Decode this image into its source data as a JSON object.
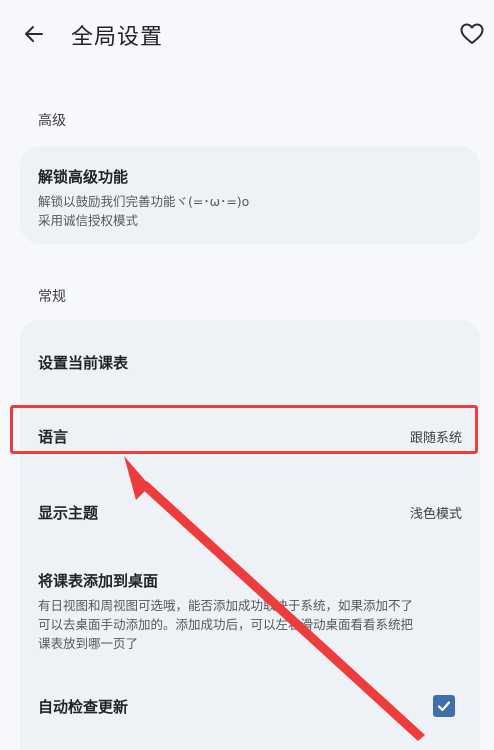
{
  "header": {
    "title": "全局设置",
    "back_icon": "arrow-left-icon",
    "favorite_icon": "heart-outline-icon"
  },
  "sections": {
    "advanced": {
      "label": "高级",
      "unlock": {
        "title": "解锁高级功能",
        "desc_line1": "解锁以鼓励我们完善功能ヾ(=･ω･=)o",
        "desc_line2": "采用诚信授权模式"
      }
    },
    "general": {
      "label": "常规",
      "current_table": {
        "title": "设置当前课表"
      },
      "language": {
        "title": "语言",
        "value": "跟随系统"
      },
      "theme": {
        "title": "显示主题",
        "value": "浅色模式"
      },
      "desktop": {
        "title": "将课表添加到桌面",
        "desc_line1": "有日视图和周视图可选哦，能否添加成功取决于系统，如果添加不了",
        "desc_line2": "可以去桌面手动添加的。添加成功后，可以左右滑动桌面看看系统把",
        "desc_line3": "课表放到哪一页了"
      },
      "auto_update": {
        "title": "自动检查更新",
        "checked": true
      }
    }
  },
  "colors": {
    "highlight": "#ee3b3b",
    "checkbox": "#3f6fa8",
    "card_bg": "#eef1f5",
    "page_bg": "#f6f8fb"
  }
}
